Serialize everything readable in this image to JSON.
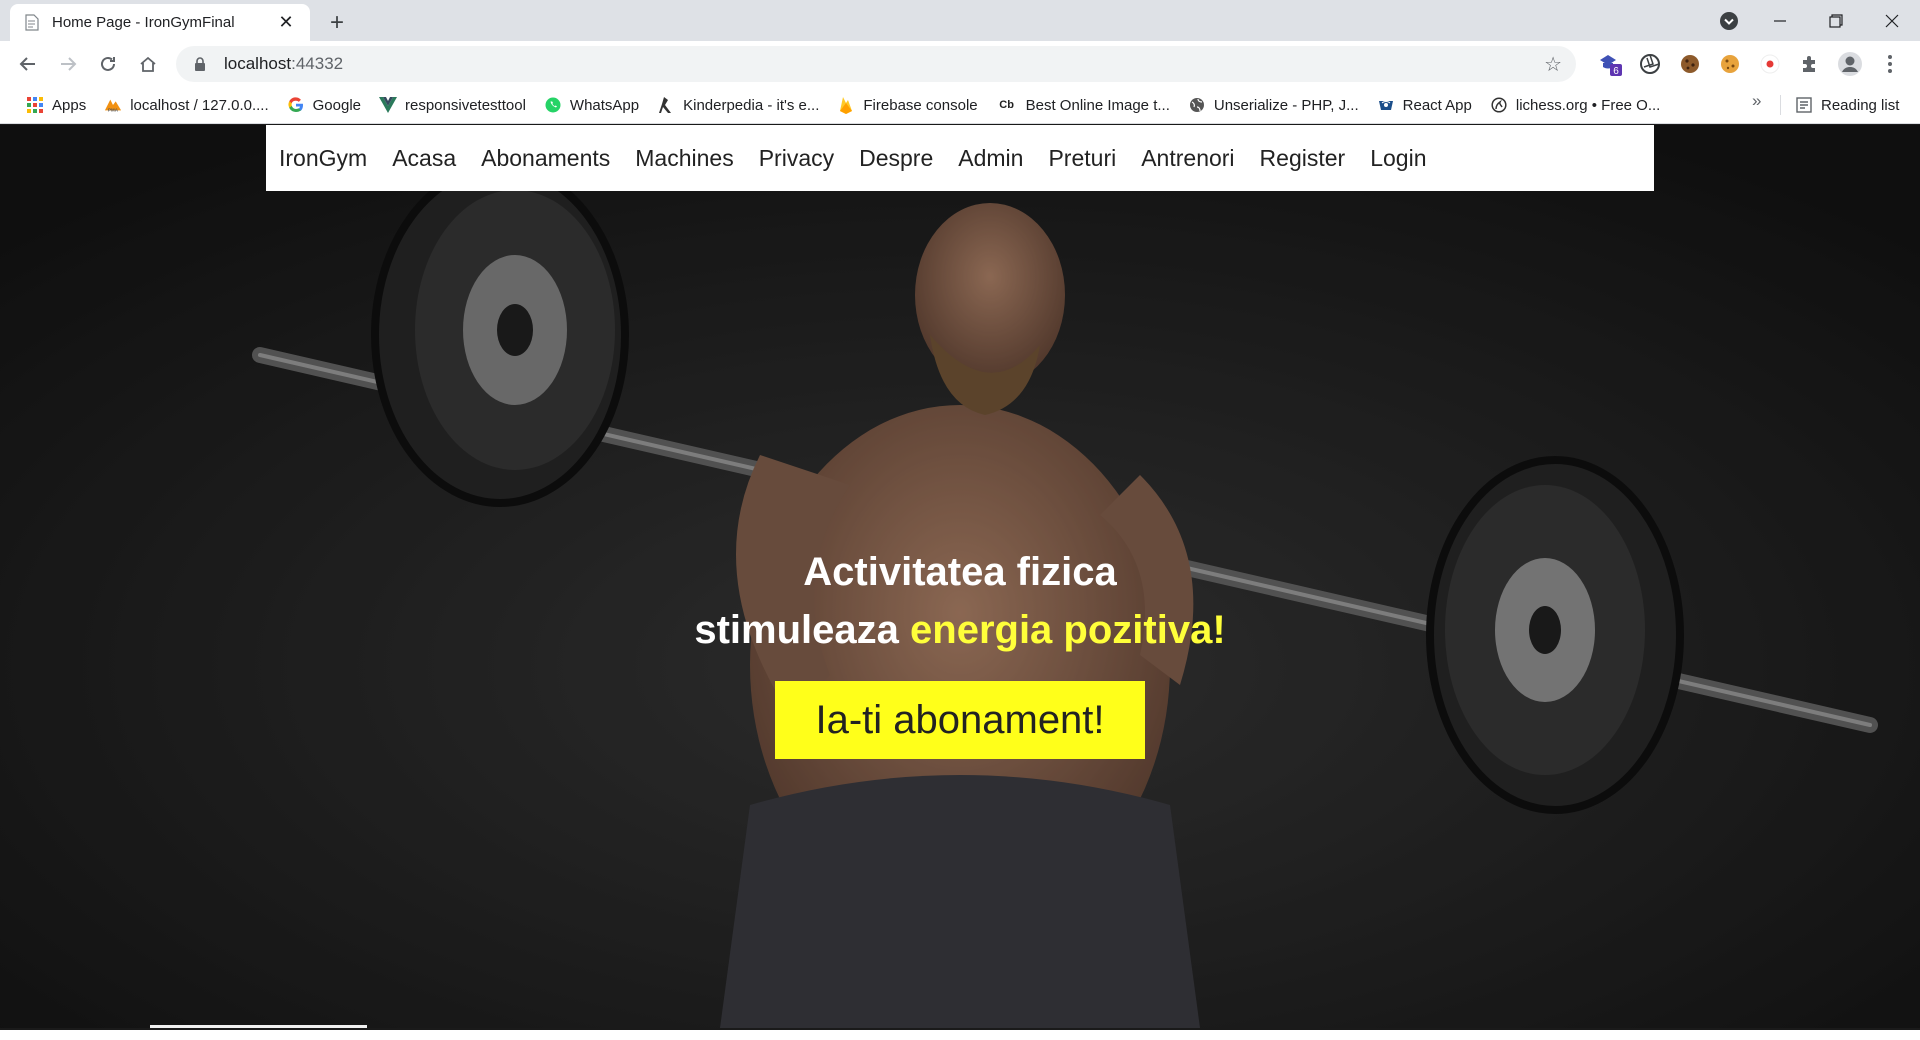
{
  "browser": {
    "tab": {
      "title": "Home Page - IronGymFinal",
      "favicon": "document-icon"
    },
    "url": {
      "host": "localhost",
      "port": ":44332"
    },
    "extension_badge": "6",
    "bookmarks": [
      {
        "label": "Apps",
        "icon": "apps-grid-icon",
        "color": "#ea4335"
      },
      {
        "label": "localhost / 127.0.0....",
        "icon": "phpmyadmin-icon",
        "color": "#f29111"
      },
      {
        "label": "Google",
        "icon": "google-icon",
        "color": "#4285f4"
      },
      {
        "label": "responsivetesttool",
        "icon": "vue-icon",
        "color": "#2b7a5b"
      },
      {
        "label": "WhatsApp",
        "icon": "whatsapp-icon",
        "color": "#25d366"
      },
      {
        "label": "Kinderpedia - it's e...",
        "icon": "kinderpedia-icon",
        "color": "#333333"
      },
      {
        "label": "Firebase console",
        "icon": "firebase-icon",
        "color": "#ffca28"
      },
      {
        "label": "Best Online Image t...",
        "icon": "cb-icon",
        "color": "#222222"
      },
      {
        "label": "Unserialize - PHP, J...",
        "icon": "globe-icon",
        "color": "#555555"
      },
      {
        "label": "React App",
        "icon": "react-icon",
        "color": "#1b4e8a"
      },
      {
        "label": "lichess.org • Free O...",
        "icon": "lichess-icon",
        "color": "#333333"
      }
    ],
    "more_bookmarks": "»",
    "reading_list": "Reading list"
  },
  "site": {
    "nav": {
      "brand": "IronGym",
      "items": [
        "Acasa",
        "Abonaments",
        "Machines",
        "Privacy",
        "Despre",
        "Admin",
        "Preturi",
        "Antrenori",
        "Register",
        "Login"
      ]
    },
    "hero": {
      "line1": "Activitatea fizica",
      "line2_prefix": "stimuleaza ",
      "line2_highlight": "energia pozitiva!",
      "cta_label": "Ia-ti abonament!"
    },
    "colors": {
      "accent": "#ffff1a",
      "highlight": "#ffff3a",
      "nav_bg": "#ffffff"
    }
  }
}
